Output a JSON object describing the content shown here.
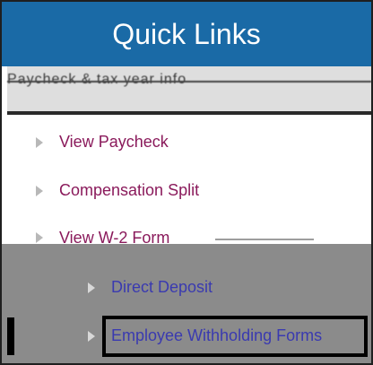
{
  "header": {
    "title": "Quick Links"
  },
  "subheader": {
    "garbled_text": "Paycheck & tax year info"
  },
  "links": [
    {
      "label": "View Paycheck"
    },
    {
      "label": "Compensation Split"
    },
    {
      "label": "View W-2 Form"
    }
  ],
  "sub_links": [
    {
      "label": "Direct Deposit"
    },
    {
      "label": "Employee Withholding Forms"
    }
  ],
  "colors": {
    "header_bg": "#1a6aa6",
    "link": "#8a1a5b",
    "sub_link": "#3a3ab0",
    "grey_panel": "#8b8b8b"
  }
}
